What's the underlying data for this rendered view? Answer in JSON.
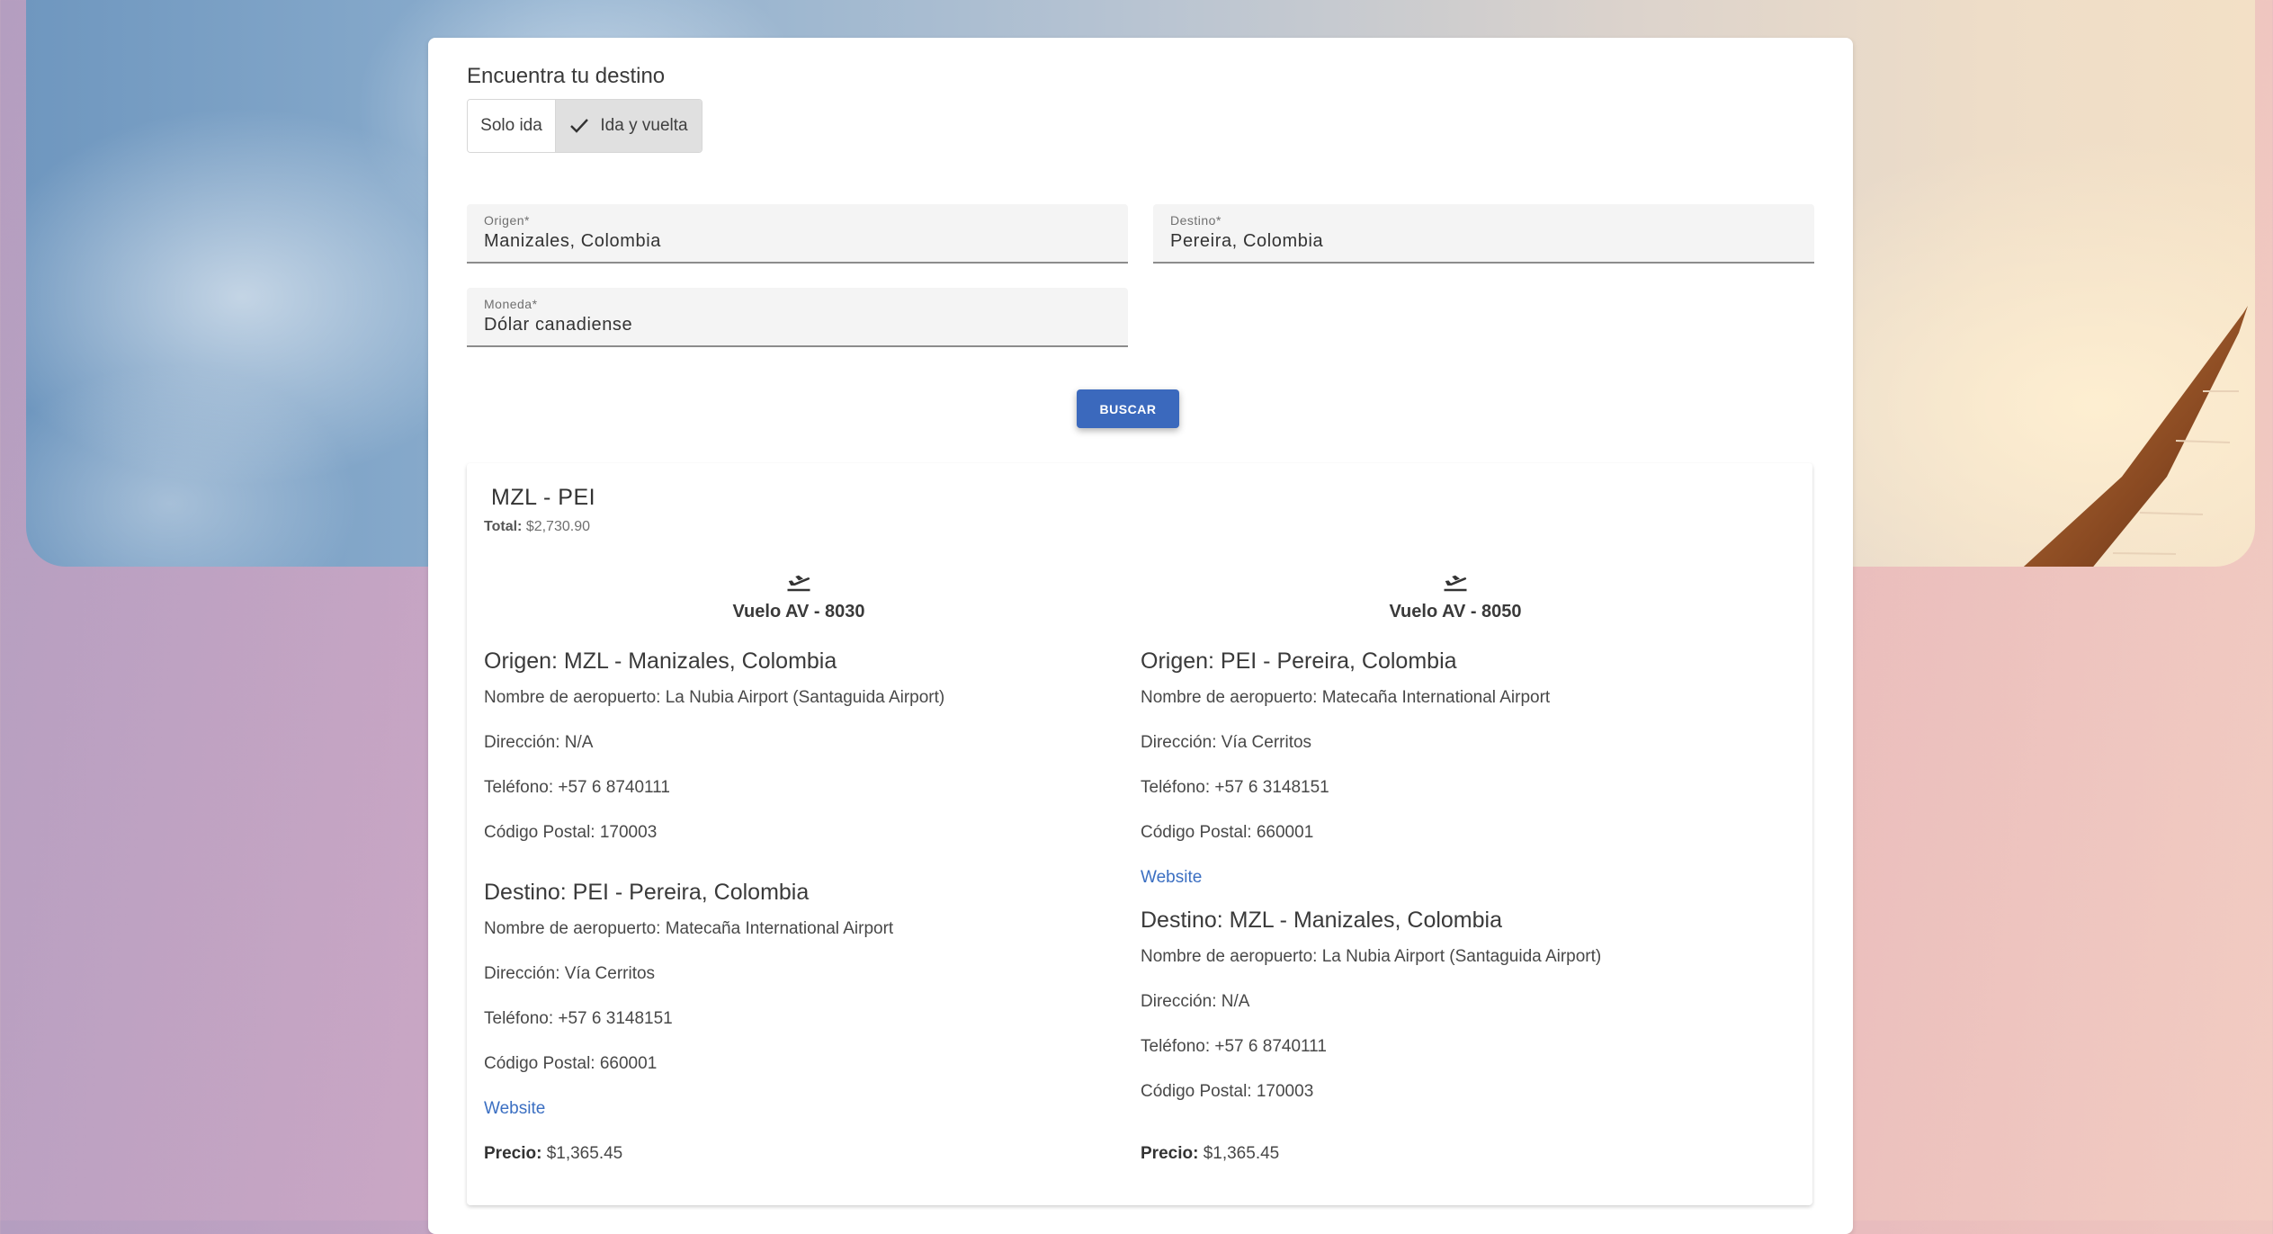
{
  "title": "Encuentra tu destino",
  "trip_type": {
    "options": [
      "Solo ida",
      "Ida y vuelta"
    ],
    "selected": "Ida y vuelta"
  },
  "form": {
    "origin": {
      "label": "Origen*",
      "value": "Manizales, Colombia"
    },
    "destination": {
      "label": "Destino*",
      "value": "Pereira, Colombia"
    },
    "currency": {
      "label": "Moneda*",
      "value": "Dólar canadiense"
    },
    "search_label": "BUSCAR"
  },
  "result": {
    "route": "MZL - PEI",
    "total_label": "Total:",
    "total_value": "$2,730.90",
    "flights": [
      {
        "flight": "Vuelo AV - 8030",
        "origin": {
          "title": "Origen: MZL - Manizales, Colombia",
          "airport": "Nombre de aeropuerto: La Nubia Airport (Santaguida Airport)",
          "address": "Dirección: N/A",
          "phone": "Teléfono: +57 6 8740111",
          "postal": "Código Postal: 170003"
        },
        "destination": {
          "title": "Destino: PEI - Pereira, Colombia",
          "airport": "Nombre de aeropuerto: Matecaña International Airport",
          "address": "Dirección: Vía Cerritos",
          "phone": "Teléfono: +57 6 3148151",
          "postal": "Código Postal: 660001",
          "website": "Website"
        },
        "price_label": "Precio:",
        "price_value": "$1,365.45"
      },
      {
        "flight": "Vuelo AV - 8050",
        "origin": {
          "title": "Origen: PEI - Pereira, Colombia",
          "airport": "Nombre de aeropuerto: Matecaña International Airport",
          "address": "Dirección: Vía Cerritos",
          "phone": "Teléfono: +57 6 3148151",
          "postal": "Código Postal: 660001",
          "website": "Website"
        },
        "destination": {
          "title": "Destino: MZL - Manizales, Colombia",
          "airport": "Nombre de aeropuerto: La Nubia Airport (Santaguida Airport)",
          "address": "Dirección: N/A",
          "phone": "Teléfono: +57 6 8740111",
          "postal": "Código Postal: 170003"
        },
        "price_label": "Precio:",
        "price_value": "$1,365.45"
      }
    ]
  },
  "colors": {
    "primary": "#3b69bd",
    "link": "#3b6fc2"
  },
  "icons": {
    "flight": "flight-takeoff-icon",
    "check": "check-icon"
  }
}
